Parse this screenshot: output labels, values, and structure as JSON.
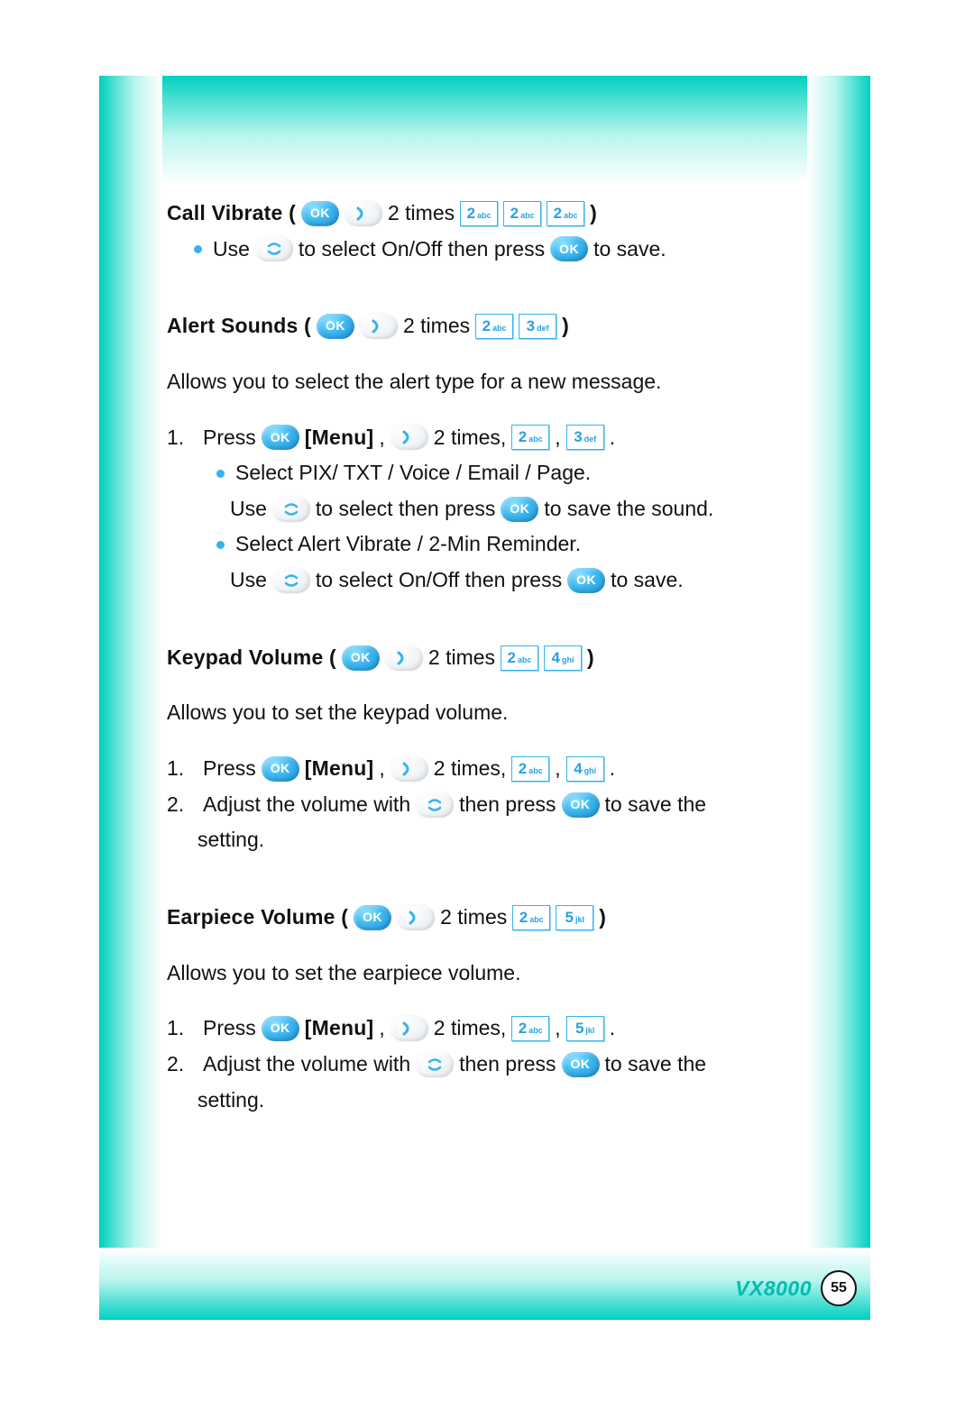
{
  "footer": {
    "model": "VX8000",
    "page": "55"
  },
  "keys": {
    "2abc_num": "2",
    "2abc_sub": "abc",
    "3def_num": "3",
    "3def_sub": "def",
    "4ghi_num": "4",
    "4ghi_sub": "ghi",
    "5jkl_num": "5",
    "5jkl_sub": "jkl"
  },
  "s1": {
    "title": "Call Vibrate (",
    "times": "2 times",
    "close": ")",
    "b1_a": "Use",
    "b1_b": "to select On/Off then press",
    "b1_c": "to save."
  },
  "s2": {
    "title": "Alert Sounds (",
    "times": "2 times",
    "close": ")",
    "desc": "Allows you to select the alert type for a new message.",
    "n1": "1.",
    "press": "Press",
    "menu": "[Menu]",
    "comma": ",",
    "times2": "2 times,",
    "dot": ".",
    "b1": "Select PIX/ TXT / Voice / Email / Page.",
    "b1l2_a": "Use",
    "b1l2_b": "to select then press",
    "b1l2_c": "to save the sound.",
    "b2": "Select Alert Vibrate / 2-Min Reminder.",
    "b2l2_a": "Use",
    "b2l2_b": "to select On/Off then press",
    "b2l2_c": "to save."
  },
  "s3": {
    "title": "Keypad Volume (",
    "times": "2 times",
    "close": ")",
    "desc": "Allows you to set the keypad volume.",
    "n1": "1.",
    "n2": "2.",
    "press": "Press",
    "menu": "[Menu]",
    "comma": ",",
    "times2": "2 times,",
    "dot": ".",
    "l2_a": "Adjust the volume with",
    "l2_b": "then press",
    "l2_c": "to save the",
    "l2_d": "setting."
  },
  "s4": {
    "title": "Earpiece Volume (",
    "times": "2 times",
    "close": ")",
    "desc": "Allows you to set the earpiece volume.",
    "n1": "1.",
    "n2": "2.",
    "press": "Press",
    "menu": "[Menu]",
    "comma": ",",
    "times2": "2 times,",
    "dot": ".",
    "l2_a": "Adjust the volume with",
    "l2_b": "then press",
    "l2_c": "to save the",
    "l2_d": "setting."
  }
}
